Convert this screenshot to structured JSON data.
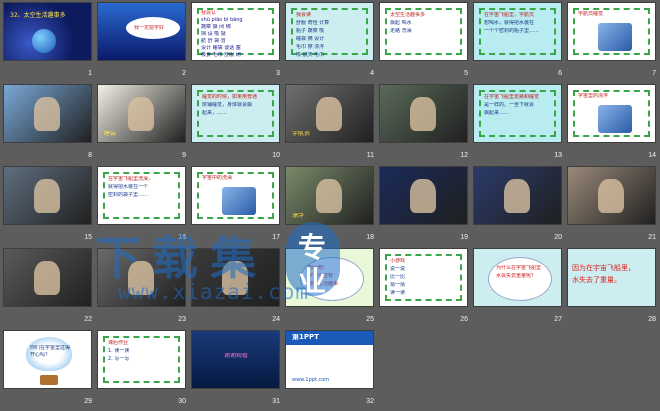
{
  "window": {
    "title": "32、太空生活趣事多"
  },
  "slides": [
    {
      "num": "1",
      "kind": "title",
      "bg": "#0d1a5e",
      "texts": [
        "32、太空生活趣事多"
      ]
    },
    {
      "num": "2",
      "kind": "space-bubble",
      "bg": "#1a3a8a",
      "texts": [
        "我一定能学好"
      ]
    },
    {
      "num": "3",
      "kind": "vocab",
      "bg": "#ffffff",
      "texts": [
        "我会认",
        "shū  piāo  bì  bǎng",
        "蔬菜 飘 闭 绑",
        "挡 设 吸 疑",
        "航 舒 袋 冒",
        "设计 睡袋 谈话 塞",
        "吸食 毛巾 舒服 刷"
      ]
    },
    {
      "num": "4",
      "kind": "words",
      "bg": "#cdeef0",
      "texts": [
        "我会读",
        "舒服 奇怪 计算",
        "瓶子 蔬菜 吸",
        "睡袋 摘 设计",
        "毛巾 擦 漂浮",
        "吸 航天 毛巾"
      ]
    },
    {
      "num": "5",
      "kind": "words",
      "bg": "#ffffff",
      "texts": [
        "太空生活趣事多",
        "飘起 喝水",
        "走路 洗澡"
      ]
    },
    {
      "num": "6",
      "kind": "text",
      "bg": "#b8ecf0",
      "texts": [
        "在宇宙飞船里，宇航员",
        "想喝水，就得把水装在",
        "一个个密封的瓶子里……"
      ]
    },
    {
      "num": "7",
      "kind": "image-frame",
      "bg": "#ffffff",
      "texts": [
        "宇航员睡觉"
      ]
    },
    {
      "num": "8",
      "kind": "photo",
      "bg": "#7aa8d8",
      "texts": []
    },
    {
      "num": "9",
      "kind": "photo-caption",
      "bg": "#f4f0e6",
      "texts": [
        "睡袋"
      ]
    },
    {
      "num": "10",
      "kind": "text",
      "bg": "#cdeef0",
      "texts": [
        "睡觉的时候，如果用普通",
        "床铺睡觉，身体就会飘",
        "起来，……"
      ]
    },
    {
      "num": "11",
      "kind": "photo-caption",
      "bg": "#707070",
      "texts": [
        "宇航员"
      ]
    },
    {
      "num": "12",
      "kind": "photo",
      "bg": "#5a6a5a",
      "texts": []
    },
    {
      "num": "13",
      "kind": "text",
      "bg": "#b8ecf0",
      "texts": [
        "在宇宙飞船里走路和睡觉",
        "是一样的。一坐下就会",
        "飘起来……"
      ]
    },
    {
      "num": "14",
      "kind": "image-frame",
      "bg": "#ffffff",
      "texts": [
        "宇宙里的漂浮"
      ]
    },
    {
      "num": "15",
      "kind": "photo",
      "bg": "#5f6f7f",
      "texts": []
    },
    {
      "num": "16",
      "kind": "text",
      "bg": "#ffffff",
      "texts": [
        "在宇宙飞船里洗澡，",
        "就得把水装在一个",
        "密封的袋子里……"
      ]
    },
    {
      "num": "17",
      "kind": "image-frame",
      "bg": "#ffffff",
      "texts": [
        "宇宙中的洗澡"
      ]
    },
    {
      "num": "18",
      "kind": "photo-caption",
      "bg": "#7a8a6a",
      "texts": [
        "漂浮"
      ]
    },
    {
      "num": "19",
      "kind": "photo",
      "bg": "#1a2a5a",
      "texts": []
    },
    {
      "num": "20",
      "kind": "photo",
      "bg": "#2a3a6a",
      "texts": []
    },
    {
      "num": "21",
      "kind": "photo",
      "bg": "#9a8a7a",
      "texts": []
    },
    {
      "num": "22",
      "kind": "photo",
      "bg": "#5a5a5a",
      "texts": []
    },
    {
      "num": "23",
      "kind": "photo",
      "bg": "#6a6a6a",
      "texts": []
    },
    {
      "num": "24",
      "kind": "photo",
      "bg": "#3a3a3a",
      "texts": []
    },
    {
      "num": "25",
      "kind": "bubble",
      "bg": "#e8f8d8",
      "texts": [
        "想一想：",
        "宇宙中还有",
        "哪些生活趣事"
      ]
    },
    {
      "num": "26",
      "kind": "words",
      "bg": "#ffffff",
      "texts": [
        "小游戏",
        "说一说",
        "比一比",
        "猜一猜",
        "读一读"
      ]
    },
    {
      "num": "27",
      "kind": "bubble",
      "bg": "#cdeef0",
      "texts": [
        "为什么在宇宙飞船里",
        "水会失去重量呢？"
      ]
    },
    {
      "num": "28",
      "kind": "answer",
      "bg": "#cdeef0",
      "texts": [
        "因为在宇宙飞船里，",
        "水失去了重量。"
      ]
    },
    {
      "num": "29",
      "kind": "balloon",
      "bg": "#ffffff",
      "texts": [
        "你们在宇宙里过得",
        "开心吗？"
      ]
    },
    {
      "num": "30",
      "kind": "text",
      "bg": "#ffffff",
      "texts": [
        "课后作业",
        "1. 读一读",
        "2. 写一写"
      ]
    },
    {
      "num": "31",
      "kind": "night",
      "bg": "#0a2a5a",
      "texts": [
        "谢谢观看"
      ]
    },
    {
      "num": "32",
      "kind": "brand",
      "bg": "#ffffff",
      "texts": [
        "第1PPT",
        "www.1ppt.com"
      ]
    }
  ],
  "watermark": {
    "chars": [
      "下",
      "载",
      "集"
    ],
    "badge_top": "专",
    "badge_bottom": "业",
    "url": "www.xiazai.com",
    "color": "#1e6ec8"
  }
}
